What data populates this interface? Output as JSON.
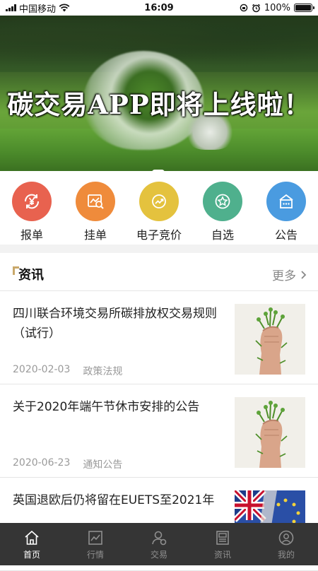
{
  "status": {
    "carrier": "中国移动",
    "time": "16:09",
    "battery": "100%",
    "battery_level": 1.0
  },
  "banner": {
    "title": "碳交易APP即将上线啦！",
    "page_count": 1,
    "active_page": 1
  },
  "quick_nav": [
    {
      "label": "报单",
      "icon": "yen-refresh-icon",
      "color": "#e8624f"
    },
    {
      "label": "挂单",
      "icon": "chart-search-icon",
      "color": "#ef8b3b"
    },
    {
      "label": "电子竞价",
      "icon": "trend-up-icon",
      "color": "#e4c23e"
    },
    {
      "label": "自选",
      "icon": "star-icon",
      "color": "#4fb08d"
    },
    {
      "label": "公告",
      "icon": "announcement-icon",
      "color": "#4a9be0"
    }
  ],
  "news": {
    "title": "资讯",
    "more": "更多",
    "items": [
      {
        "title": "四川联合环境交易所碳排放权交易规则（试行）",
        "date": "2020-02-03",
        "category": "政策法规",
        "thumb": "fist-with-plants-image"
      },
      {
        "title": "关于2020年端午节休市安排的公告",
        "date": "2020-06-23",
        "category": "通知公告",
        "thumb": "fist-with-plants-image"
      },
      {
        "title": "英国退欧后仍将留在EUETS至2021年",
        "date": "",
        "category": "",
        "thumb": "uk-eu-flag-image"
      }
    ]
  },
  "tabs": [
    {
      "label": "首页",
      "icon": "home-icon",
      "active": true
    },
    {
      "label": "行情",
      "icon": "market-chart-icon",
      "active": false
    },
    {
      "label": "交易",
      "icon": "trade-icon",
      "active": false
    },
    {
      "label": "资讯",
      "icon": "news-icon",
      "active": false
    },
    {
      "label": "我的",
      "icon": "profile-icon",
      "active": false
    }
  ]
}
